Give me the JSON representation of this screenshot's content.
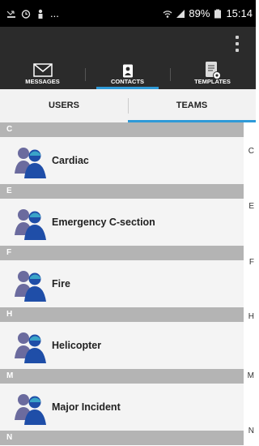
{
  "status_bar": {
    "left_text": "...",
    "battery": "89%",
    "time": "15:14"
  },
  "main_tabs": [
    {
      "label": "MESSAGES",
      "icon": "envelope-icon"
    },
    {
      "label": "CONTACTS",
      "icon": "contact-card-icon",
      "active": true
    },
    {
      "label": "TEMPLATES",
      "icon": "document-gear-icon"
    }
  ],
  "sub_tabs": [
    {
      "label": "USERS"
    },
    {
      "label": "TEAMS",
      "active": true
    }
  ],
  "sections": [
    {
      "letter": "C",
      "items": [
        "Cardiac"
      ]
    },
    {
      "letter": "E",
      "items": [
        "Emergency C-section"
      ]
    },
    {
      "letter": "F",
      "items": [
        "Fire"
      ]
    },
    {
      "letter": "H",
      "items": [
        "Helicopter"
      ]
    },
    {
      "letter": "M",
      "items": [
        "Major Incident"
      ]
    },
    {
      "letter": "N",
      "items": []
    }
  ],
  "index_letters": [
    "C",
    "E",
    "F",
    "H",
    "M",
    "N"
  ],
  "colors": {
    "accent": "#2f9ad8",
    "section_header": "#b4b4b4",
    "action_bar": "#2b2b2b"
  }
}
